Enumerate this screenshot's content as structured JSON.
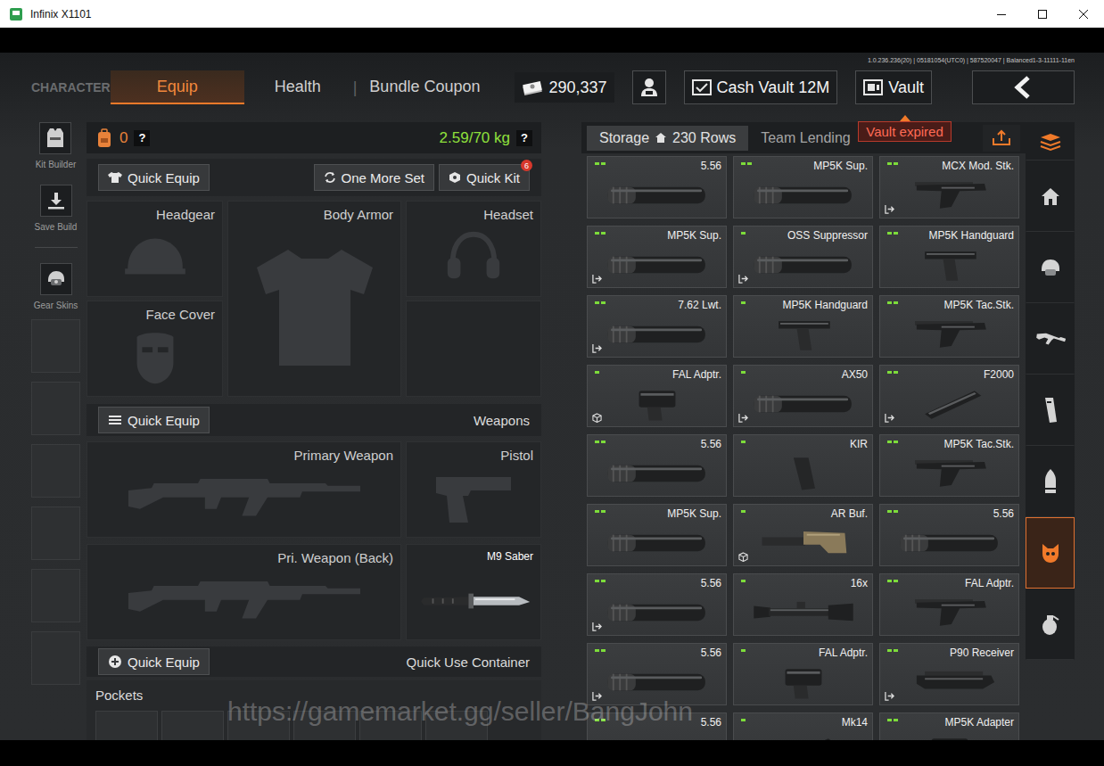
{
  "window": {
    "title": "Infinix X1101"
  },
  "build_info": "1.0.236.236(20) | 05181054(UTC0) | 587520047 | Balanced1-3-11111-11en",
  "nav": {
    "section": "CHARACTER",
    "separator": "|",
    "tabs": [
      {
        "label": "Equip",
        "selected": true,
        "separator_before": false
      },
      {
        "label": "Health",
        "selected": false,
        "separator_before": false
      },
      {
        "label": "Bundle Coupon",
        "selected": false,
        "separator_before": true
      }
    ]
  },
  "currency": {
    "amount": "290,337"
  },
  "cash_vault": {
    "label": "Cash Vault 12M"
  },
  "vault": {
    "label": "Vault",
    "status": "Vault expired"
  },
  "tools": [
    {
      "label": "Kit Builder",
      "kind": "kit"
    },
    {
      "label": "Save Build",
      "kind": "save"
    },
    {
      "label": "Gear Skins",
      "kind": "skins"
    }
  ],
  "loadout": {
    "backpack_count": "0",
    "help": "?",
    "weight": "2.59/70 kg",
    "actions": {
      "quick_equip": "Quick Equip",
      "one_more_set": "One More Set",
      "quick_kit": "Quick Kit",
      "quick_kit_badge": "6"
    },
    "gear_slots": [
      {
        "label": "Headgear",
        "kind": "helmet",
        "equipped": false
      },
      {
        "label": "Body Armor",
        "kind": "armor",
        "equipped": false
      },
      {
        "label": "Headset",
        "kind": "headset",
        "equipped": false
      },
      {
        "label": "Face Cover",
        "kind": "mask",
        "equipped": false
      },
      {
        "label": "",
        "kind": "empty",
        "equipped": false
      }
    ],
    "weapons_bar": {
      "button": "Quick Equip",
      "label": "Weapons"
    },
    "weapon_slots": [
      {
        "label": "Primary Weapon",
        "kind": "rifle",
        "equipped": false
      },
      {
        "label": "Pistol",
        "kind": "pistol",
        "equipped": false
      },
      {
        "label": "Pri. Weapon (Back)",
        "kind": "rifle",
        "equipped": false
      },
      {
        "label": "M9 Saber",
        "kind": "knife",
        "equipped": true
      }
    ],
    "quick_use_bar": {
      "button": "Quick Equip",
      "label": "Quick Use Container"
    },
    "pockets": {
      "label": "Pockets"
    }
  },
  "storage": {
    "tabs": [
      {
        "label": "Storage",
        "detail": "230 Rows",
        "selected": true
      },
      {
        "label": "Team Lending",
        "detail": "",
        "selected": false
      }
    ],
    "items": [
      {
        "name": "5.56",
        "grade": 2,
        "kind": "suppressor",
        "marker": "none"
      },
      {
        "name": "MP5K Sup.",
        "grade": 2,
        "kind": "suppressor",
        "marker": "none"
      },
      {
        "name": "MCX Mod. Stk.",
        "grade": 2,
        "kind": "stock",
        "marker": "exit"
      },
      {
        "name": "MP5K Sup.",
        "grade": 2,
        "kind": "suppressor",
        "marker": "exit"
      },
      {
        "name": "OSS Suppressor",
        "grade": 1,
        "kind": "suppressor",
        "marker": "exit"
      },
      {
        "name": "MP5K Handguard",
        "grade": 2,
        "kind": "handguard",
        "marker": "none"
      },
      {
        "name": "7.62 Lwt.",
        "grade": 2,
        "kind": "suppressor",
        "marker": "exit"
      },
      {
        "name": "MP5K Handguard",
        "grade": 1,
        "kind": "handguard",
        "marker": "none"
      },
      {
        "name": "MP5K Tac.Stk.",
        "grade": 2,
        "kind": "stock",
        "marker": "none"
      },
      {
        "name": "FAL Adptr.",
        "grade": 1,
        "kind": "adapter",
        "marker": "cube"
      },
      {
        "name": "AX50",
        "grade": 1,
        "kind": "suppressor",
        "marker": "exit"
      },
      {
        "name": "F2000",
        "grade": 2,
        "kind": "rail",
        "marker": "exit"
      },
      {
        "name": "5.56",
        "grade": 2,
        "kind": "suppressor",
        "marker": "none"
      },
      {
        "name": "KIR",
        "grade": 1,
        "kind": "magazine",
        "marker": "none"
      },
      {
        "name": "MP5K Tac.Stk.",
        "grade": 2,
        "kind": "stock",
        "marker": "none"
      },
      {
        "name": "MP5K Sup.",
        "grade": 2,
        "kind": "suppressor",
        "marker": "none"
      },
      {
        "name": "AR Buf.",
        "grade": 1,
        "kind": "buffer",
        "marker": "cube"
      },
      {
        "name": "5.56",
        "grade": 2,
        "kind": "suppressor",
        "marker": "none"
      },
      {
        "name": "5.56",
        "grade": 2,
        "kind": "suppressor",
        "marker": "exit"
      },
      {
        "name": "16x",
        "grade": 1,
        "kind": "scope",
        "marker": "none"
      },
      {
        "name": "FAL Adptr.",
        "grade": 2,
        "kind": "stock",
        "marker": "none"
      },
      {
        "name": "5.56",
        "grade": 2,
        "kind": "suppressor",
        "marker": "exit"
      },
      {
        "name": "FAL Adptr.",
        "grade": 1,
        "kind": "adapter",
        "marker": "none"
      },
      {
        "name": "P90 Receiver",
        "grade": 2,
        "kind": "receiver",
        "marker": "exit"
      },
      {
        "name": "5.56",
        "grade": 2,
        "kind": "suppressor",
        "marker": "none"
      },
      {
        "name": "Mk14",
        "grade": 1,
        "kind": "rail",
        "marker": "none"
      },
      {
        "name": "MP5K Adapter",
        "grade": 2,
        "kind": "adapter",
        "marker": "none"
      }
    ]
  },
  "categories": [
    {
      "kind": "collapse",
      "selected": false
    },
    {
      "kind": "home",
      "selected": false
    },
    {
      "kind": "gear",
      "selected": false
    },
    {
      "kind": "weapons",
      "selected": false
    },
    {
      "kind": "magazines",
      "selected": false
    },
    {
      "kind": "ammo",
      "selected": false
    },
    {
      "kind": "attachments",
      "selected": true
    },
    {
      "kind": "throwables",
      "selected": false
    }
  ],
  "watermark": "https://gamemarket.gg/seller/BangJohn"
}
